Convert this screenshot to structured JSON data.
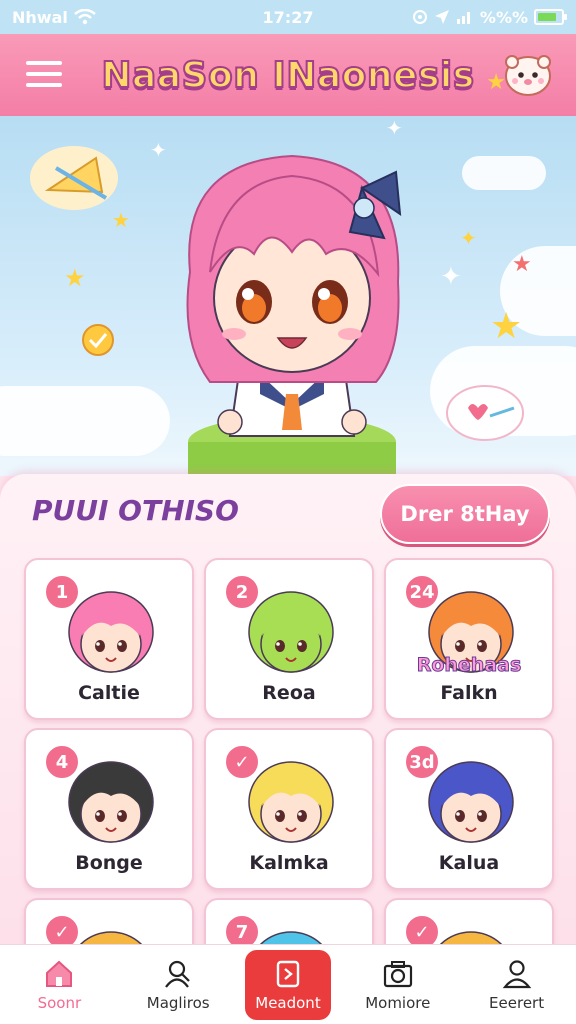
{
  "status_bar": {
    "carrier": "Nhwal",
    "time": "17:27",
    "battery_label": "%%%",
    "battery_level": 0.8,
    "icons": [
      "wifi-icon",
      "location-icon",
      "cellular-icon",
      "battery-icon"
    ]
  },
  "app": {
    "title": "NaaSon INaonesis"
  },
  "section": {
    "title": "PUUI OTHISO",
    "action_label": "Drer 8tHay"
  },
  "cards": [
    {
      "badge": "1",
      "name": "Caltie",
      "hair": "#f97cb3",
      "skin": "#ffe3d2"
    },
    {
      "badge": "2",
      "name": "Reoa",
      "hair": "#a8de54",
      "skin": "#a8de54"
    },
    {
      "badge": "24",
      "name": "Falkn",
      "overlay": "Rohehaas",
      "hair": "#f58a3a",
      "skin": "#ffe3d2"
    },
    {
      "badge": "4",
      "name": "Bonge",
      "hair": "#3a3a3a",
      "skin": "#ffe3d2"
    },
    {
      "badge": "✓",
      "name": "Kalmka",
      "hair": "#f7dc5a",
      "skin": "#ffe3d2"
    },
    {
      "badge": "3d",
      "name": "Kalua",
      "hair": "#4b56c9",
      "skin": "#ffe3d2"
    },
    {
      "badge": "✓",
      "name": "",
      "hair": "#f5b642",
      "skin": "#ffe3d2"
    },
    {
      "badge": "7",
      "name": "",
      "hair": "#4fc3e8",
      "skin": "#ffe3d2"
    },
    {
      "badge": "✓",
      "name": "",
      "hair": "#f5b642",
      "skin": "#ffe3d2"
    }
  ],
  "bottom_nav": [
    {
      "label": "Soonr",
      "icon": "home-icon"
    },
    {
      "label": "Magliros",
      "icon": "user-search-icon"
    },
    {
      "label": "Meadont",
      "icon": "tag-icon"
    },
    {
      "label": "Momiore",
      "icon": "camera-icon"
    },
    {
      "label": "Eeerert",
      "icon": "profile-icon"
    }
  ],
  "colors": {
    "header_pink": "#f47ea6",
    "accent_red": "#ea3c3c",
    "title_purple": "#7b3f9e",
    "badge_pink": "#f26d8d"
  }
}
